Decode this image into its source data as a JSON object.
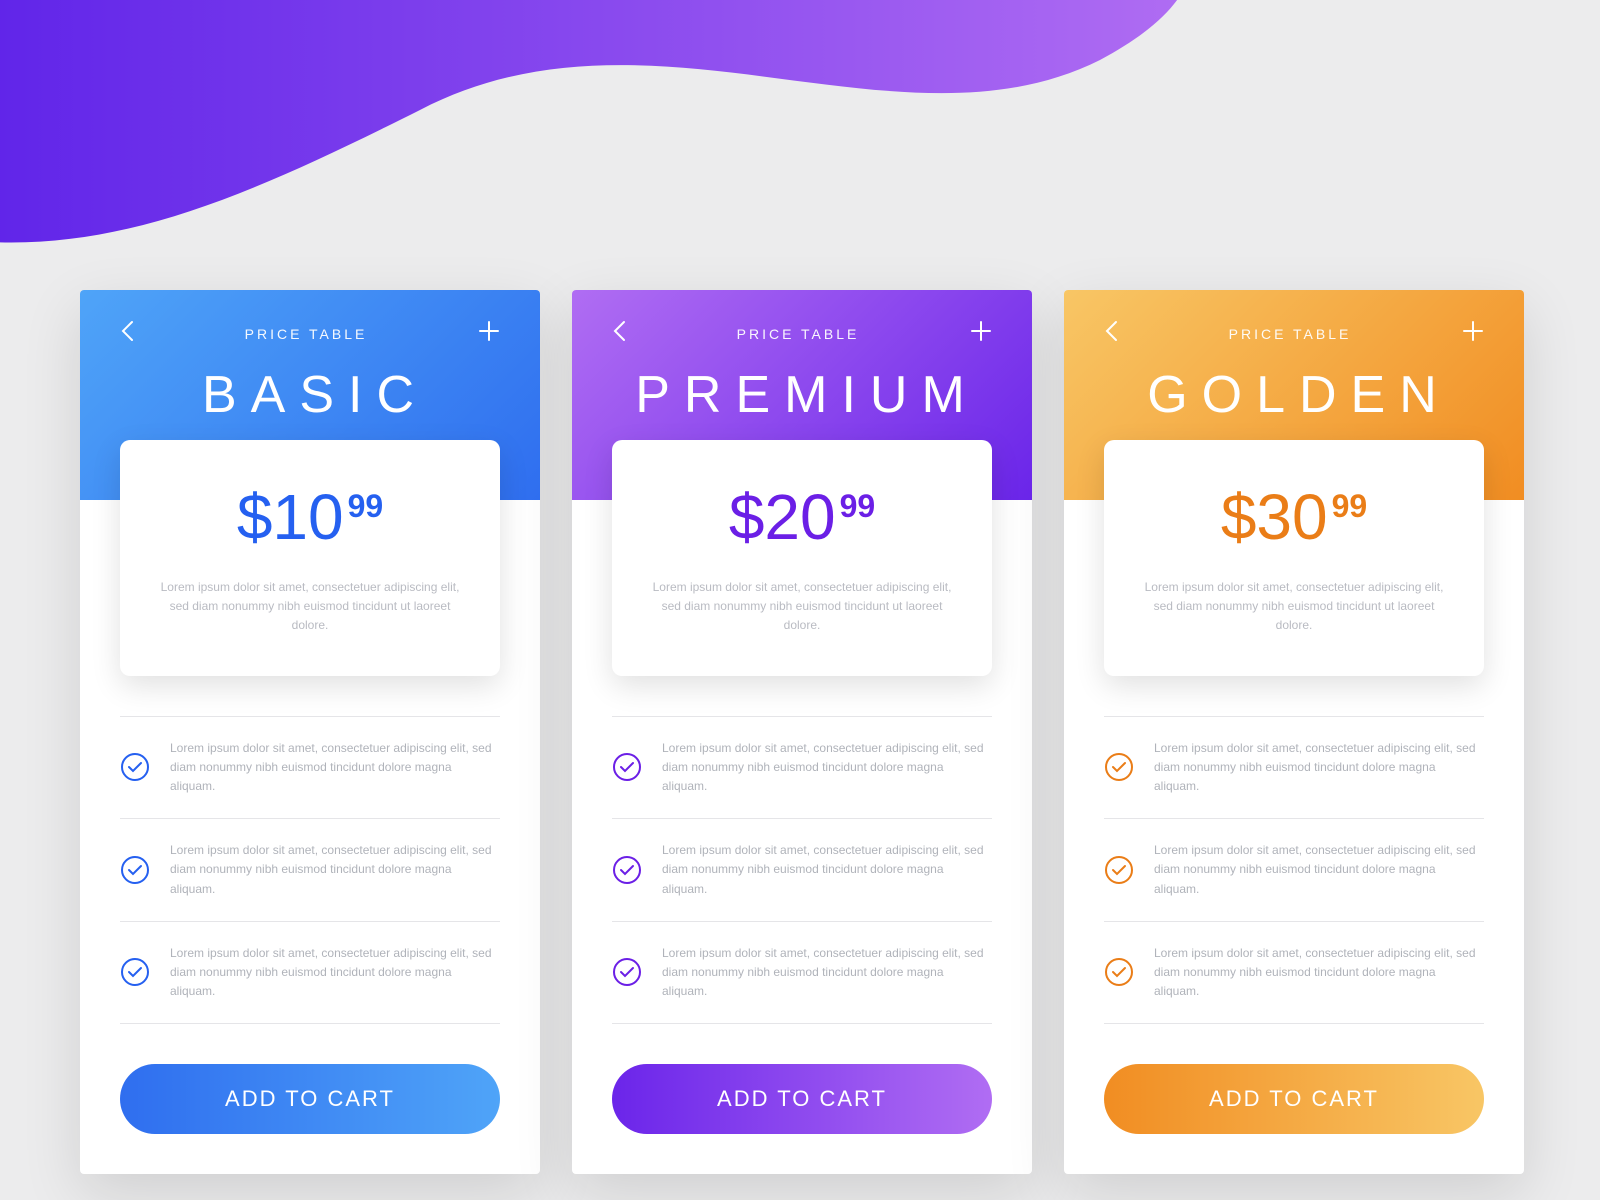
{
  "placeholder_desc": "Lorem ipsum dolor sit amet, consectetuer adipiscing elit, sed diam nonummy nibh euismod tincidunt ut laoreet dolore.",
  "placeholder_feature": "Lorem ipsum dolor sit amet, consectetuer adipiscing elit, sed diam nonummy nibh euismod tincidunt dolore magna aliquam.",
  "subtitle": "PRICE TABLE",
  "cta": "ADD TO CART",
  "plans": [
    {
      "id": "basic",
      "name": "BASIC",
      "price_main": "$10",
      "price_cents": "99",
      "accent": "#2560f0"
    },
    {
      "id": "premium",
      "name": "PREMIUM",
      "price_main": "$20",
      "price_cents": "99",
      "accent": "#6b1fe6"
    },
    {
      "id": "golden",
      "name": "GOLDEN",
      "price_main": "$30",
      "price_cents": "99",
      "accent": "#ea7d17"
    }
  ]
}
